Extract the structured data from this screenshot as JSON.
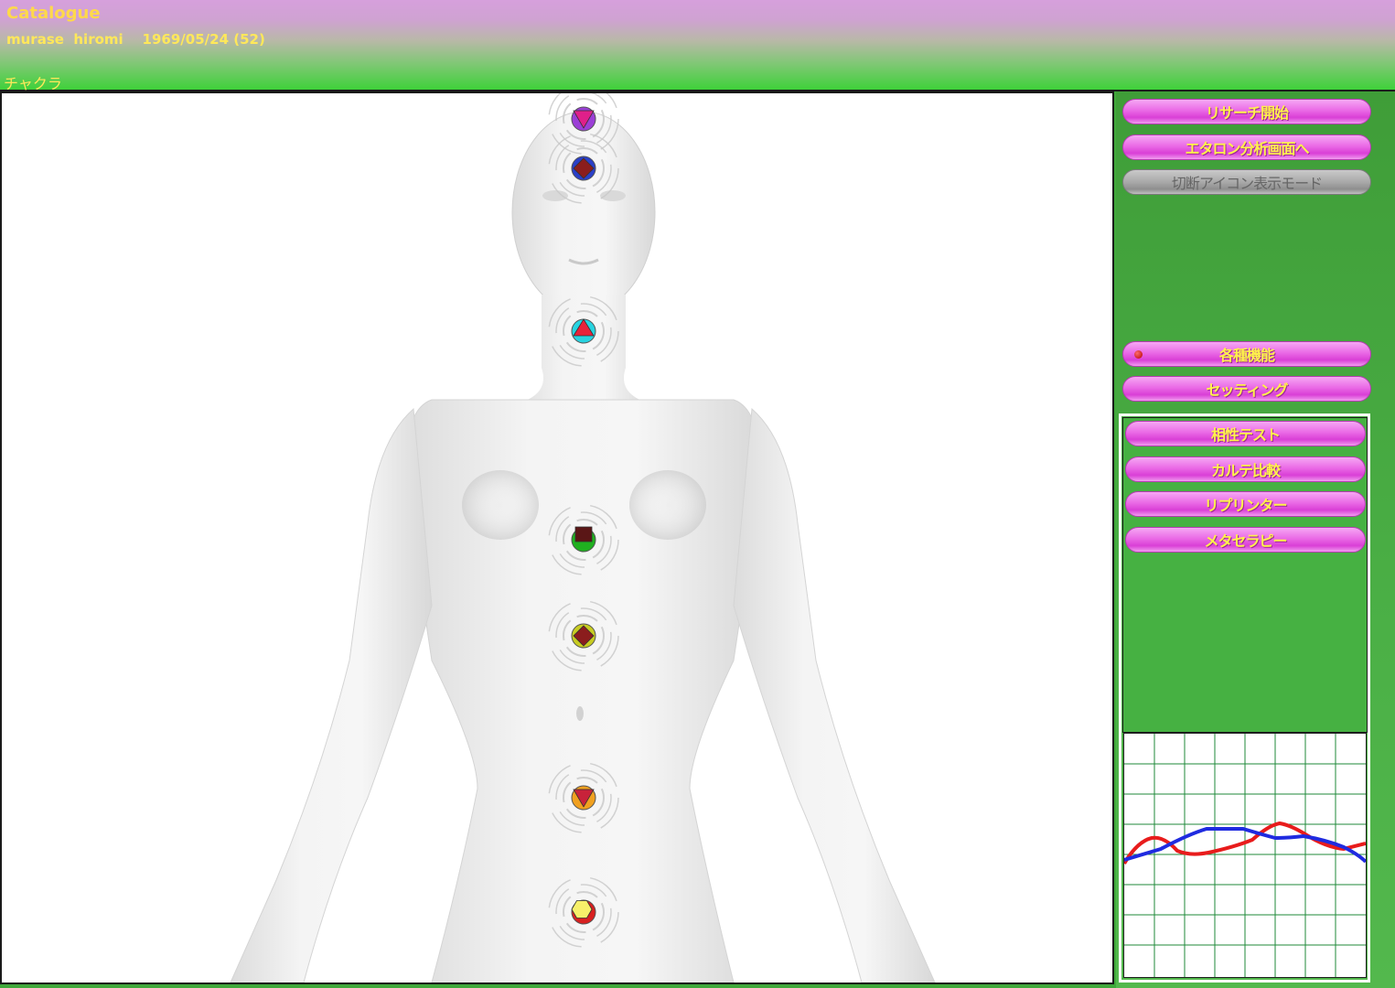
{
  "header": {
    "app_title": "Catalogue",
    "user_line": "murase  hiromi    1969/05/24 (52)",
    "section_title": "チャクラ"
  },
  "chakras": [
    {
      "name": "crown",
      "shape": "triangle-down",
      "shape_color": "#e0208a",
      "ring_color": "#9b3fd6"
    },
    {
      "name": "third-eye",
      "shape": "diamond",
      "shape_color": "#8b1d1d",
      "ring_color": "#2a3fc8"
    },
    {
      "name": "throat",
      "shape": "triangle-up",
      "shape_color": "#e8223a",
      "ring_color": "#28d3e0"
    },
    {
      "name": "heart",
      "shape": "square",
      "shape_color": "#5a1616",
      "ring_color": "#20b020"
    },
    {
      "name": "solar-plexus",
      "shape": "diamond",
      "shape_color": "#8b1d1d",
      "ring_color": "#c8cc22"
    },
    {
      "name": "sacral",
      "shape": "triangle-down",
      "shape_color": "#c8223a",
      "ring_color": "#f0a020"
    },
    {
      "name": "root",
      "shape": "hexagon",
      "shape_color": "#f7f06a",
      "ring_color": "#d82020"
    }
  ],
  "right_panel": {
    "top_buttons": [
      {
        "label": "リサーチ開始",
        "enabled": true
      },
      {
        "label": "エタロン分析画面へ",
        "enabled": true
      },
      {
        "label": "切断アイコン表示モード",
        "enabled": false
      }
    ],
    "functions_label": "各種機能",
    "settings_label": "セッティング",
    "sub_buttons": [
      "相性テスト",
      "カルテ比較",
      "リプリンター",
      "メタセラピー"
    ]
  },
  "colors": {
    "accent_pink": "#e85ee3",
    "header_text": "#ffe85a",
    "panel_green": "#46b142",
    "graph_grid": "#1f8a3a",
    "series_red": "#e81c1c",
    "series_blue": "#1f2be0"
  }
}
